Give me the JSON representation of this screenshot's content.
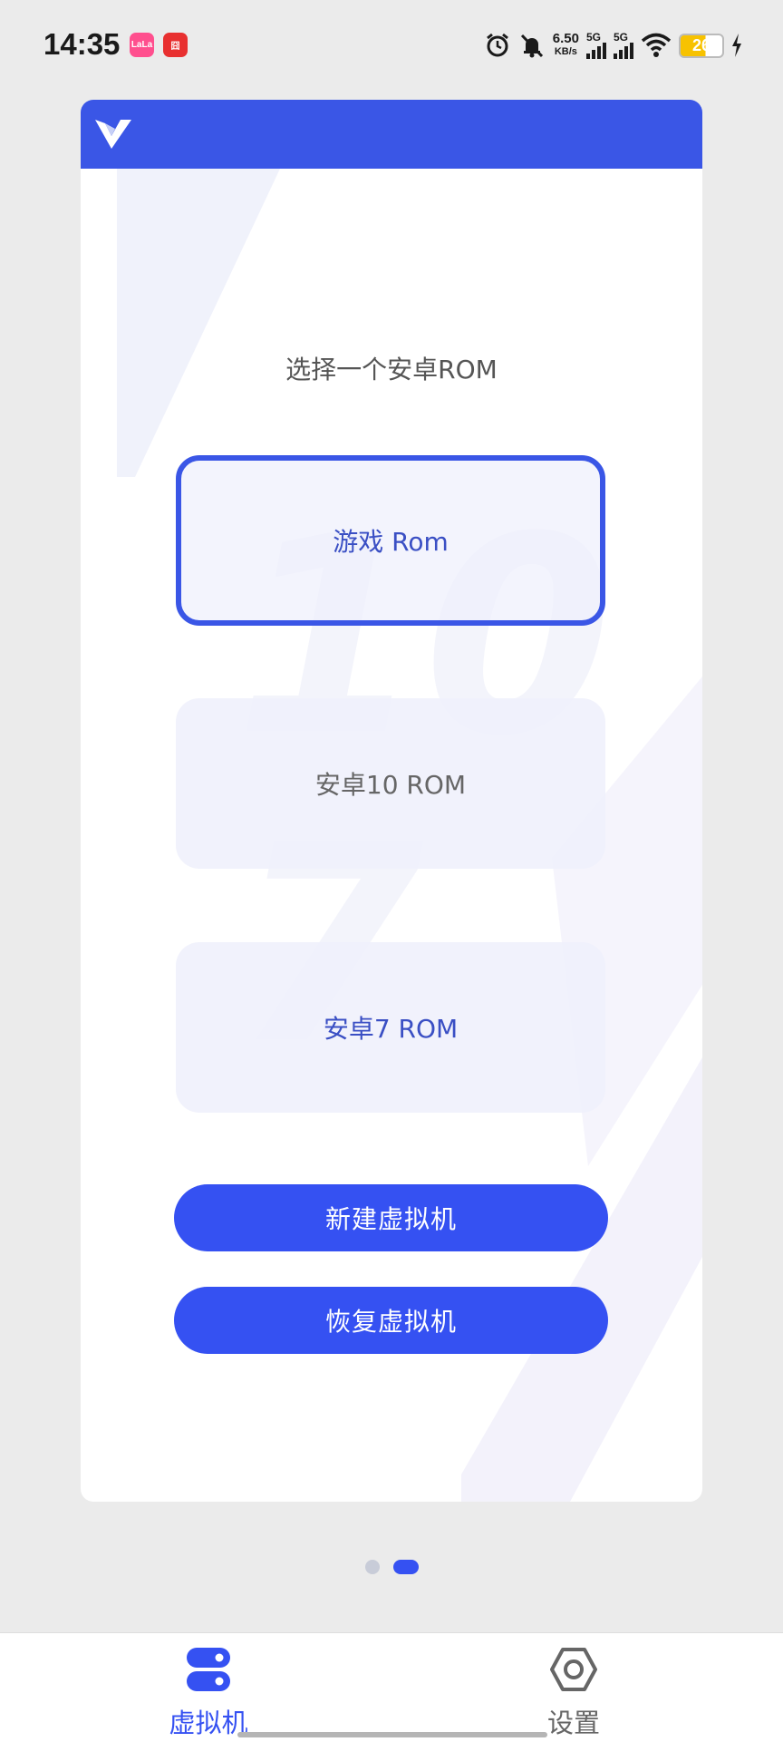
{
  "status_bar": {
    "time": "14:35",
    "app_badge_1": "LaLa",
    "app_badge_2": "囧",
    "net_speed_value": "6.50",
    "net_speed_unit": "KB/s",
    "sim1": "5G",
    "sim2": "5G",
    "battery": "26"
  },
  "prompt": "选择一个安卓ROM",
  "rom_options": [
    {
      "label": "游戏 Rom",
      "selected": true
    },
    {
      "label": "安卓10 ROM",
      "selected": false
    },
    {
      "label": "安卓7 ROM",
      "selected": false
    }
  ],
  "actions": {
    "create": "新建虚拟机",
    "restore": "恢复虚拟机"
  },
  "pager": {
    "total": 2,
    "current": 2
  },
  "bottom_nav": [
    {
      "label": "虚拟机",
      "icon": "server-icon",
      "active": true
    },
    {
      "label": "设置",
      "icon": "hexagon-settings-icon",
      "active": false
    }
  ],
  "colors": {
    "accent": "#3551f2",
    "header": "#3a56e6",
    "background": "#ebebeb"
  }
}
